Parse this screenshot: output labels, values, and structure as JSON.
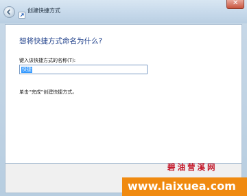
{
  "window": {
    "title": "创建快捷方式",
    "close_glyph": "✕"
  },
  "dialog": {
    "heading": "想将快捷方式命名为什么?",
    "name_label": "键入该快捷方式的名称(T):",
    "name_value": "快捷",
    "hint": "单击“完成”创建快捷方式。"
  },
  "watermark": {
    "logo_text": "碧油营溪网",
    "url": "www.laixuea.com"
  },
  "colors": {
    "accent": "#1e3f8a",
    "selection": "#3399ff",
    "watermark_band": "#f08a10",
    "watermark_logo": "#c4182a"
  }
}
